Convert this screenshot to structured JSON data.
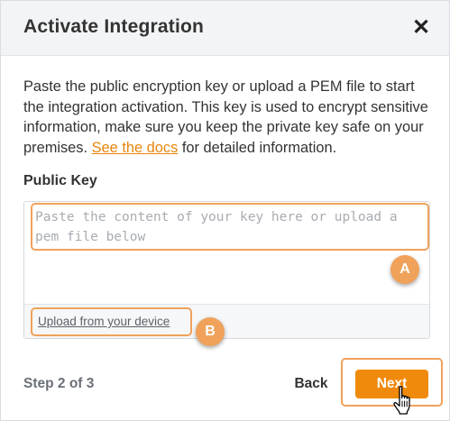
{
  "dialog": {
    "title": "Activate Integration",
    "close_symbol": "✕",
    "description_before_link": "Paste the public encryption key or upload a PEM file to start the integration activation. This key is used to encrypt sensitive information, make sure you keep the private key safe on your premises. ",
    "docs_link": "See the docs",
    "description_after_link": " for detailed information."
  },
  "public_key": {
    "label": "Public Key",
    "placeholder": "Paste the content of your key here or upload a pem file below",
    "value": "",
    "upload_link": "Upload from your device"
  },
  "annotations": {
    "a_label": "A",
    "b_label": "B",
    "highlight_color": "#f0a25b"
  },
  "footer": {
    "step_text": "Step 2 of 3",
    "back_label": "Back",
    "next_label": "Next"
  },
  "colors": {
    "accent": "#f08a0c",
    "link": "#e8850d",
    "header_bg": "#f2f4f6"
  },
  "icons": {
    "close": "close-icon",
    "cursor": "hand-pointer-cursor-icon"
  }
}
